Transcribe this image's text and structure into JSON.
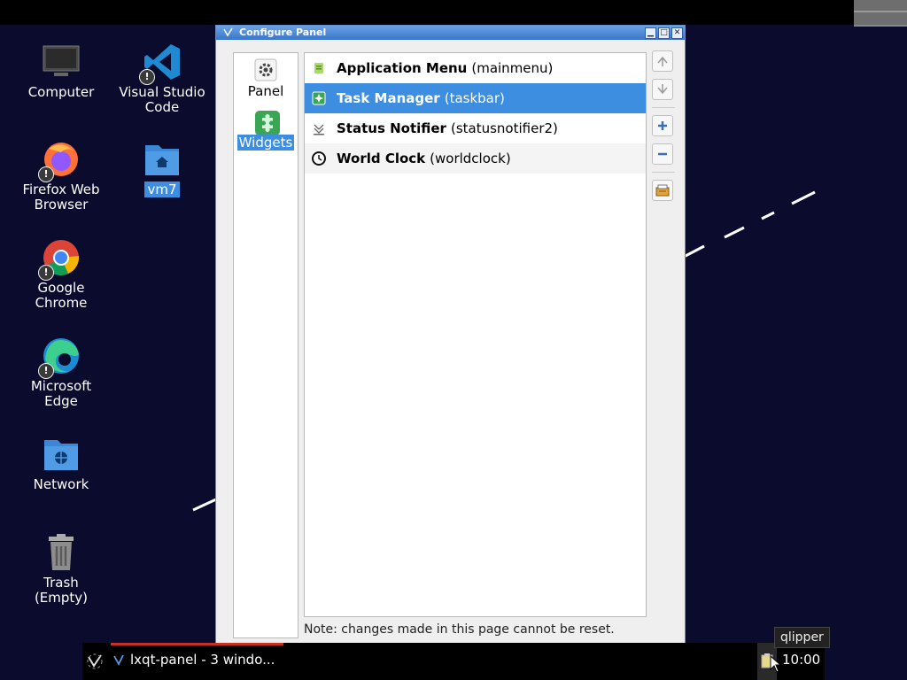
{
  "desktop": {
    "icons": [
      {
        "label": "Computer"
      },
      {
        "label": "Visual Studio\nCode"
      },
      {
        "label": "Firefox Web\nBrowser"
      },
      {
        "label": "vm7"
      },
      {
        "label": "Google\nChrome"
      },
      {
        "label": "Microsoft\nEdge"
      },
      {
        "label": "Network"
      },
      {
        "label": "Trash\n(Empty)"
      }
    ],
    "warning_mark": "!"
  },
  "dialog": {
    "title": "Configure Panel",
    "nav": [
      {
        "label": "Panel"
      },
      {
        "label": "Widgets"
      }
    ],
    "widgets": [
      {
        "name": "Application Menu",
        "id": "(mainmenu)"
      },
      {
        "name": "Task Manager",
        "id": "(taskbar)"
      },
      {
        "name": "Status Notifier",
        "id": "(statusnotifier2)"
      },
      {
        "name": "World Clock",
        "id": "(worldclock)"
      }
    ],
    "note": "Note: changes made in this page cannot be reset."
  },
  "taskbar": {
    "task_label": "lxqt-panel - 3 windo...",
    "clock": "10:00",
    "tooltip": "qlipper"
  },
  "colors": {
    "accent": "#3d8ee0",
    "desktop_bg": "#0b0b2e",
    "titlebar": "#4a86d4"
  }
}
